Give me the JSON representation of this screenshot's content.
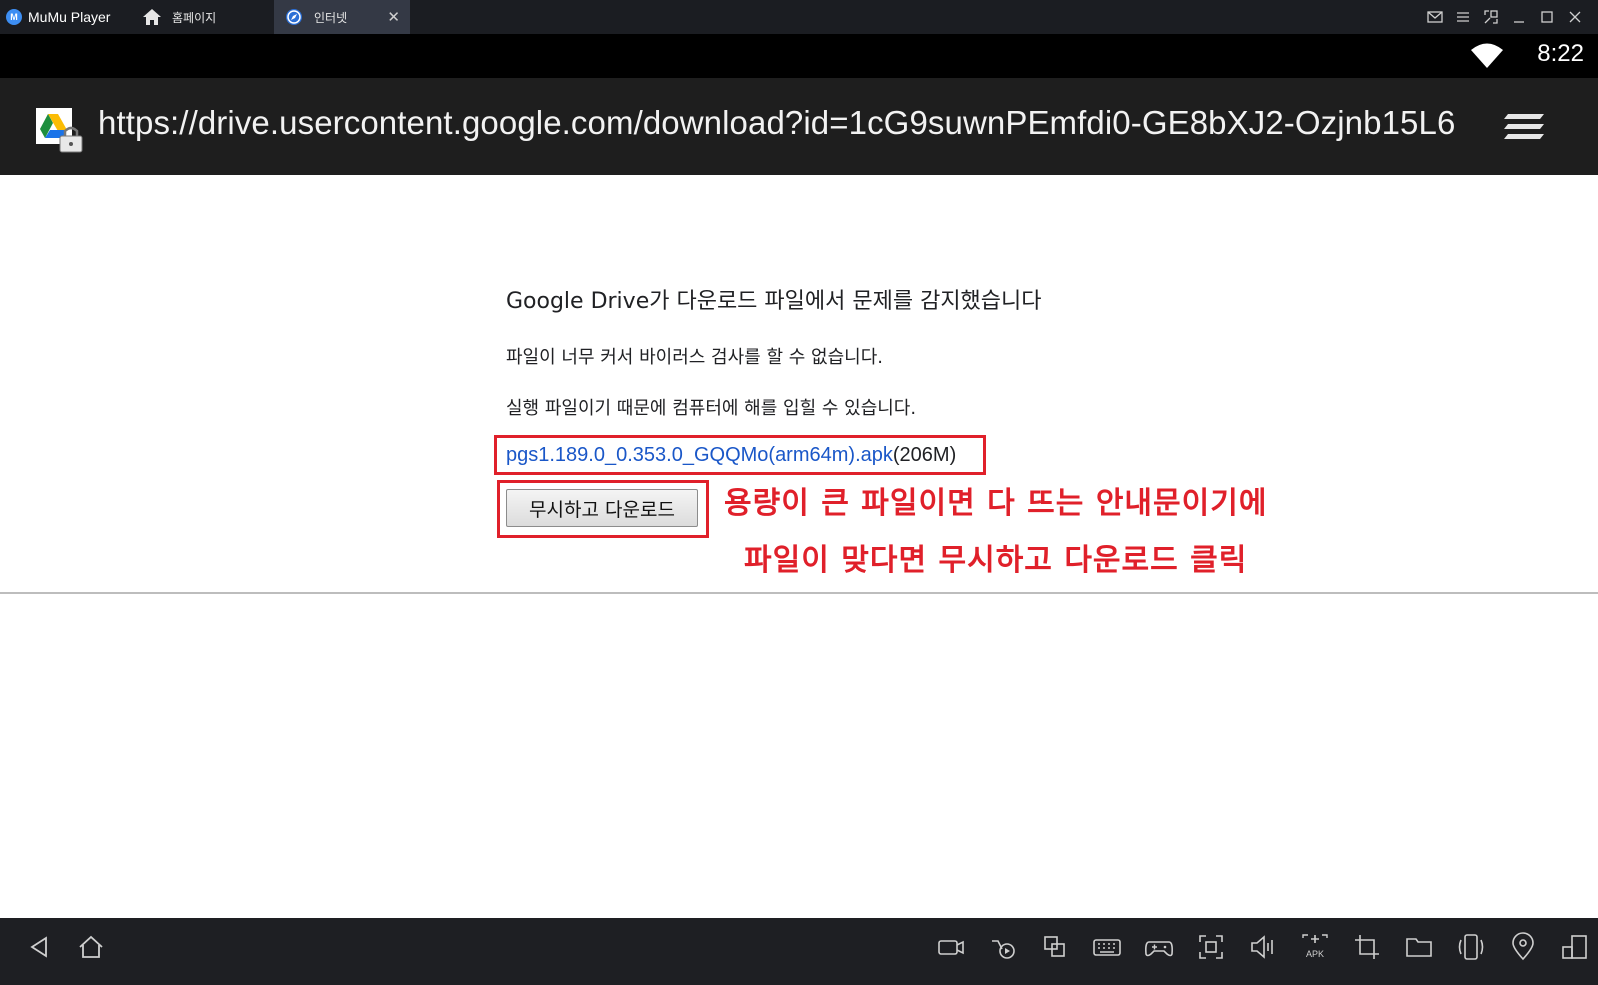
{
  "window": {
    "app_name": "MuMu Player",
    "tabs": [
      {
        "label": "홈페이지",
        "icon": "home-icon",
        "active": false
      },
      {
        "label": "인터넷",
        "icon": "browser-icon",
        "active": true
      }
    ],
    "controls": [
      "mail-icon",
      "menu-icon",
      "expand-icon",
      "minimize-icon",
      "maximize-icon",
      "close-icon"
    ]
  },
  "status_bar": {
    "time": "8:22",
    "wifi_icon": "wifi-icon"
  },
  "address_bar": {
    "url": "https://drive.usercontent.google.com/download?id=1cG9suwnPEmfdi0-GE8bXJ2-Ozjnb15L6",
    "site_icon": "google-drive-lock-icon",
    "menu_icon": "hamburger-menu-icon"
  },
  "page": {
    "title": "Google Drive가 다운로드 파일에서 문제를 감지했습니다",
    "line1": "파일이 너무 커서 바이러스 검사를 할 수 없습니다.",
    "line2": "실행 파일이기 때문에 컴퓨터에 해를 입힐 수 있습니다.",
    "file_name": "pgs1.189.0_0.353.0_GQQMo(arm64m).apk",
    "file_size": "(206M)",
    "download_button": "무시하고 다운로드",
    "annotation_line1": "용량이 큰 파일이면 다 뜨는 안내문이기에",
    "annotation_line2": "파일이 맞다면 무시하고 다운로드 클릭",
    "colors": {
      "link": "#1a57c8",
      "annotation": "#e0202a"
    }
  },
  "bottom_toolbar": {
    "nav": [
      "back-icon",
      "home-icon"
    ],
    "tools": [
      "video-record-icon",
      "screenshot-icon",
      "multi-instance-icon",
      "keyboard-icon",
      "gamepad-icon",
      "fullscreen-icon",
      "volume-icon",
      "apk-install-icon",
      "crop-icon",
      "folder-icon",
      "rotate-icon",
      "location-icon",
      "sidebar-toggle-icon"
    ],
    "apk_label": "APK"
  }
}
